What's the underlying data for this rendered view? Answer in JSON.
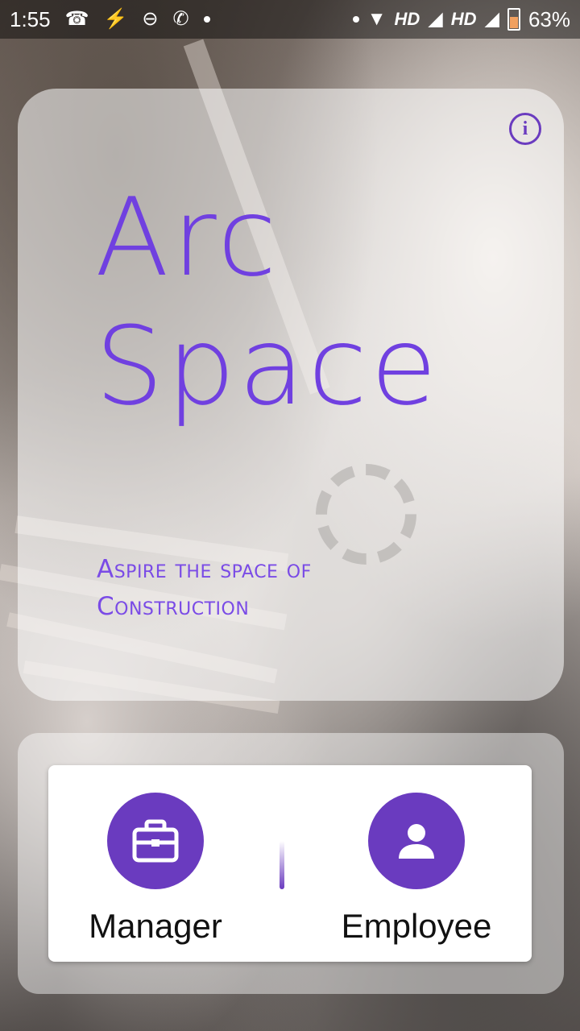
{
  "status_bar": {
    "time": "1:55",
    "network_label_1": "HD",
    "network_label_2": "HD",
    "battery_percent": "63%"
  },
  "hero": {
    "title_line1": "Arc",
    "title_line2": "Space",
    "tagline": "Aspire the space of Construction",
    "info_icon": "info-icon"
  },
  "roles": {
    "manager_label": "Manager",
    "manager_icon": "briefcase-icon",
    "employee_label": "Employee",
    "employee_icon": "person-icon"
  },
  "colors": {
    "accent": "#6a3bbf",
    "brand_text": "#7040e0"
  }
}
